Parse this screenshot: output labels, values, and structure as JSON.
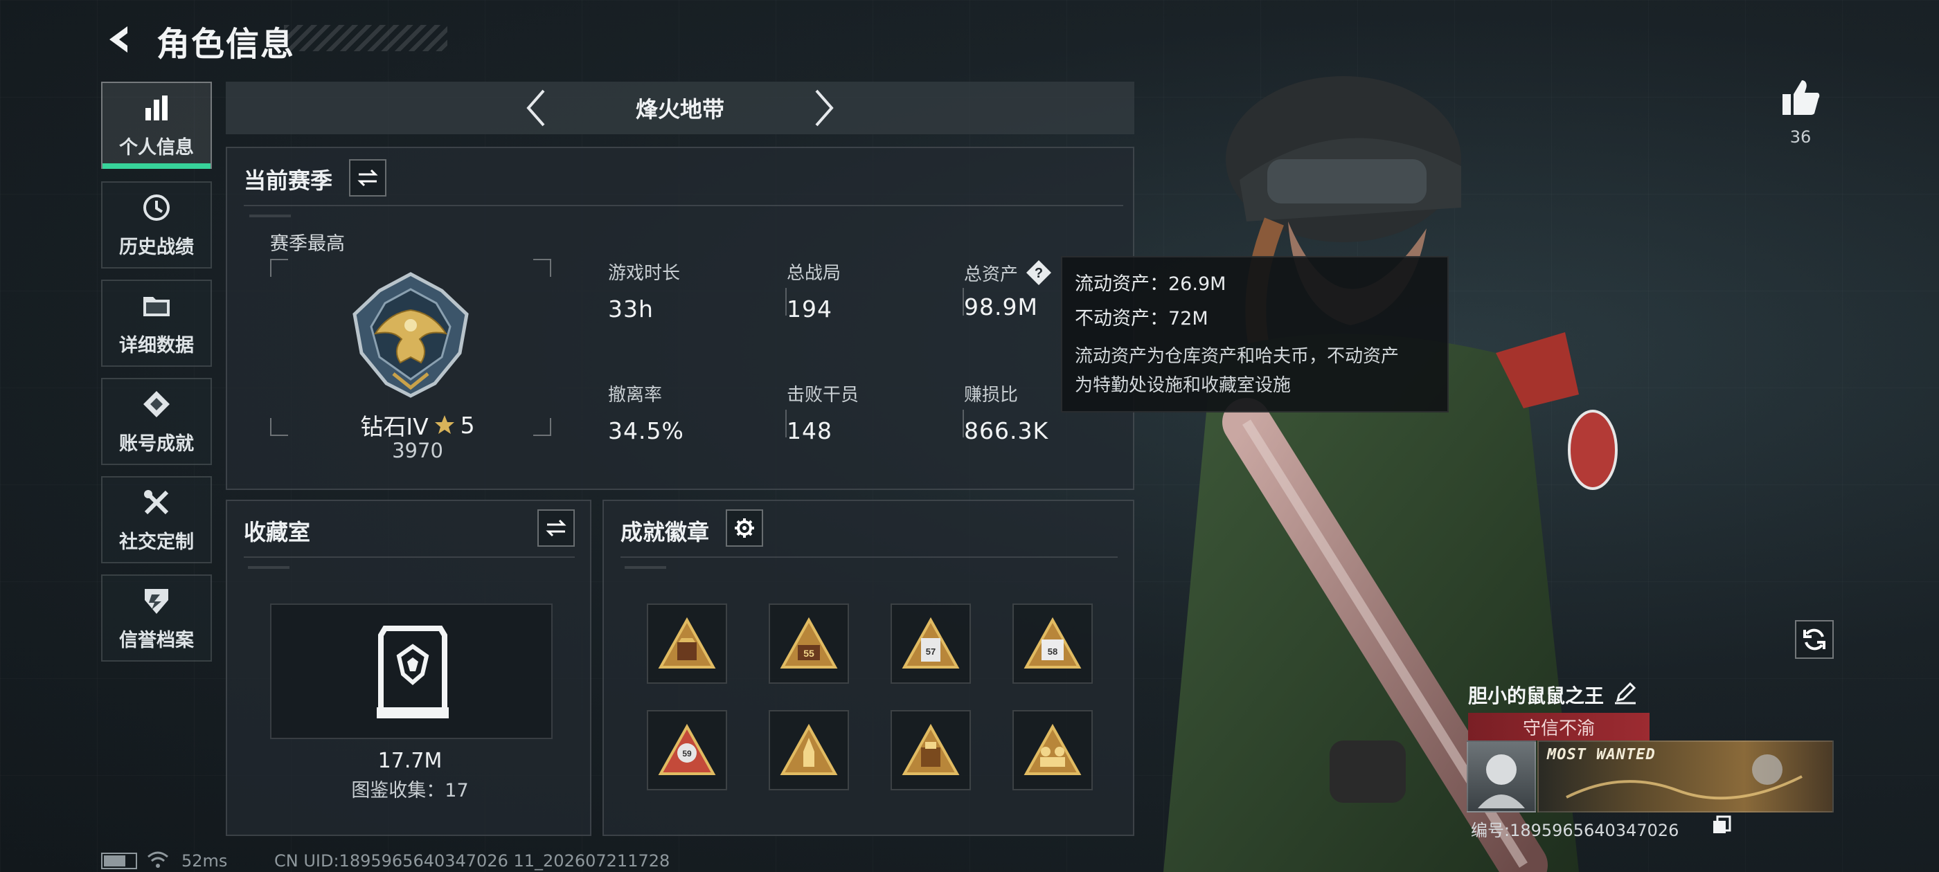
{
  "header": {
    "title": "角色信息"
  },
  "sidebar": {
    "items": [
      {
        "label": "个人信息",
        "icon": "bar-chart-icon",
        "active": true
      },
      {
        "label": "历史战绩",
        "icon": "history-icon",
        "active": false
      },
      {
        "label": "详细数据",
        "icon": "folder-icon",
        "active": false
      },
      {
        "label": "账号成就",
        "icon": "achievement-icon",
        "active": false
      },
      {
        "label": "社交定制",
        "icon": "tools-icon",
        "active": false
      },
      {
        "label": "信誉档案",
        "icon": "shield-icon",
        "active": false
      }
    ]
  },
  "mode": {
    "name": "烽火地带"
  },
  "season": {
    "title": "当前赛季",
    "best_label": "赛季最高",
    "rank_name": "钻石IV",
    "rank_stars": "5",
    "rank_points": "3970",
    "stats": [
      {
        "label": "游戏时长",
        "value": "33h"
      },
      {
        "label": "总战局",
        "value": "194"
      },
      {
        "label": "总资产",
        "value": "98.9M"
      },
      {
        "label": "撤离率",
        "value": "34.5%"
      },
      {
        "label": "击败干员",
        "value": "148"
      },
      {
        "label": "赚损比",
        "value": "866.3K"
      }
    ]
  },
  "tooltip": {
    "liquid": "流动资产：26.9M",
    "fixed": "不动资产：72M",
    "desc_line1": "流动资产为仓库资产和哈夫币，不动资产",
    "desc_line2": "为特勤处设施和收藏室设施"
  },
  "collection": {
    "title": "收藏室",
    "value": "17.7M",
    "catalog": "图鉴收集：17"
  },
  "badges": {
    "title": "成就徽章",
    "items": [
      "badge-1",
      "badge-55",
      "badge-57",
      "badge-58",
      "badge-59",
      "badge-rocket",
      "badge-gold",
      "badge-team"
    ],
    "numbers": [
      "",
      "55",
      "57",
      "58",
      "59",
      "",
      "",
      ""
    ]
  },
  "likes": {
    "count": "36"
  },
  "player": {
    "name": "胆小的鼠鼠之王",
    "honor": "守信不渝",
    "banner_text": "MOST WANTED",
    "id_label": "编号:1895965640347026"
  },
  "footer": {
    "ping": "52ms",
    "uid": "CN UID:1895965640347026 11_202607211728"
  },
  "colors": {
    "accent": "#37d39a",
    "honor_red": "#9c2b31",
    "gold": "#c9a24a"
  }
}
